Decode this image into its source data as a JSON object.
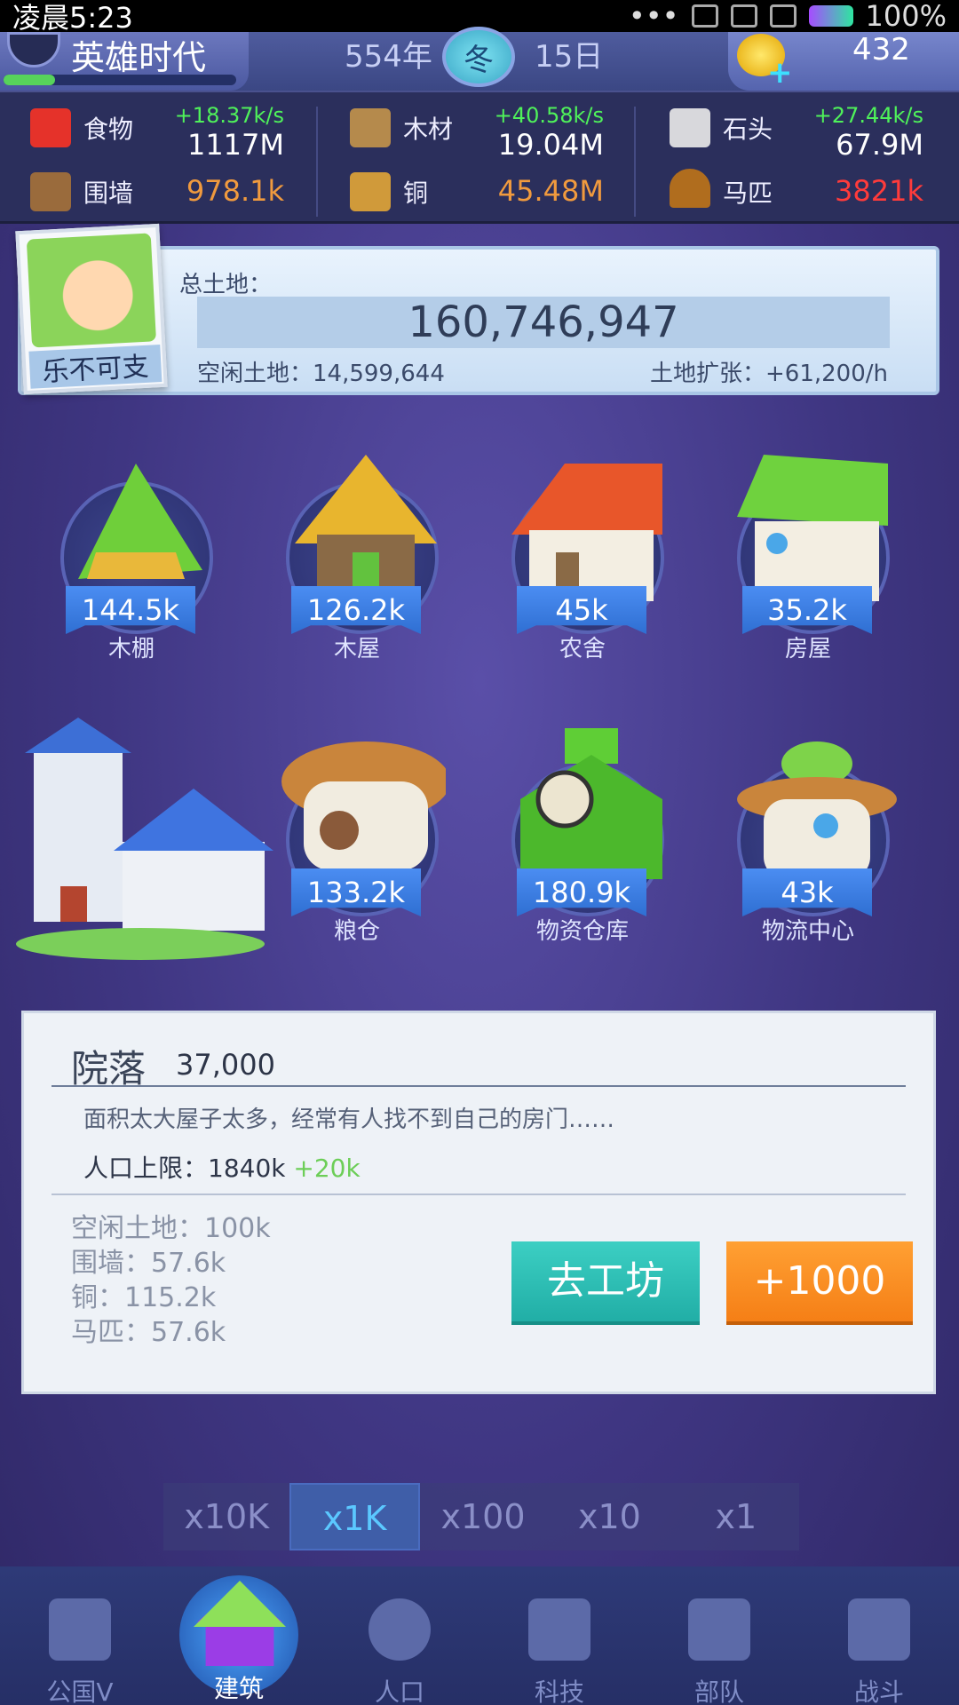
{
  "status_bar": {
    "time": "凌晨5:23",
    "battery": "100%"
  },
  "top": {
    "era_title": "英雄时代",
    "era_progress": 0.22,
    "year": "554年",
    "season": "冬",
    "day": "15日",
    "coins": "432"
  },
  "resources": {
    "food": {
      "name": "食物",
      "rate": "+18.37k/s",
      "value": "1117M"
    },
    "wood": {
      "name": "木材",
      "rate": "+40.58k/s",
      "value": "19.04M"
    },
    "stone": {
      "name": "石头",
      "rate": "+27.44k/s",
      "value": "67.9M"
    },
    "wall": {
      "name": "围墙",
      "value": "978.1k"
    },
    "copper": {
      "name": "铜",
      "value": "45.48M"
    },
    "horse": {
      "name": "马匹",
      "value": "3821k"
    }
  },
  "colors": {
    "orange_value": "#f09a3e",
    "red_value": "#ff3b3b",
    "rate_green": "#4ff25a"
  },
  "player": {
    "name": "乐不可支",
    "land_label": "总土地：",
    "land_total": "160,746,947",
    "idle_land": "空闲土地：14,599,644",
    "land_expand": "土地扩张：+61,200/h"
  },
  "buildings": [
    {
      "name": "木棚",
      "count": "144.5k"
    },
    {
      "name": "木屋",
      "count": "126.2k"
    },
    {
      "name": "农舍",
      "count": "45k"
    },
    {
      "name": "房屋",
      "count": "35.2k"
    },
    {
      "name": "粮仓",
      "count": "133.2k"
    },
    {
      "name": "物资仓库",
      "count": "180.9k"
    },
    {
      "name": "物流中心",
      "count": "43k"
    }
  ],
  "detail": {
    "title": "院落",
    "cost": "37,000",
    "description": "面积太大屋子太多，经常有人找不到自己的房门……",
    "pop_label": "人口上限：1840k",
    "pop_plus": "+20k",
    "requirements": [
      "空闲土地：100k",
      "围墙：57.6k",
      "铜：115.2k",
      "马匹：57.6k"
    ],
    "workshop_button": "去工坊",
    "add_button": "+1000"
  },
  "multipliers": [
    "x10K",
    "x1K",
    "x100",
    "x10",
    "x1"
  ],
  "nav": [
    "公国V",
    "建筑",
    "人口",
    "科技",
    "部队",
    "战斗"
  ]
}
